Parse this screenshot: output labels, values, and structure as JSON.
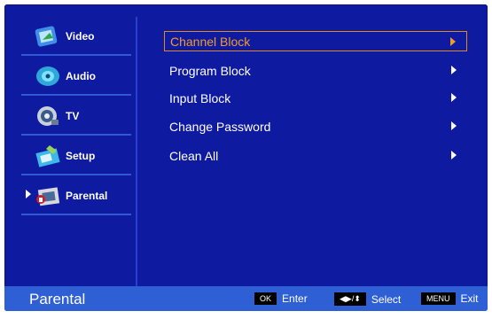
{
  "sidebar": {
    "items": [
      {
        "label": "Video",
        "icon": "video-icon"
      },
      {
        "label": "Audio",
        "icon": "audio-icon"
      },
      {
        "label": "TV",
        "icon": "tv-icon"
      },
      {
        "label": "Setup",
        "icon": "setup-icon"
      },
      {
        "label": "Parental",
        "icon": "parental-icon",
        "active": true
      }
    ]
  },
  "menu": {
    "items": [
      {
        "label": "Channel Block",
        "selected": true
      },
      {
        "label": "Program Block"
      },
      {
        "label": "Input Block"
      },
      {
        "label": "Change Password"
      },
      {
        "label": "Clean All"
      }
    ]
  },
  "footer": {
    "title": "Parental",
    "hints": [
      {
        "key": "OK",
        "label": "Enter"
      },
      {
        "key": "◀▶/⬍",
        "label": "Select"
      },
      {
        "key": "MENU",
        "label": "Exit"
      }
    ]
  },
  "colors": {
    "background": "#0e1aa0",
    "footer": "#2f5fd4",
    "highlight": "#f29a2e",
    "divider": "#2e5ad8"
  }
}
